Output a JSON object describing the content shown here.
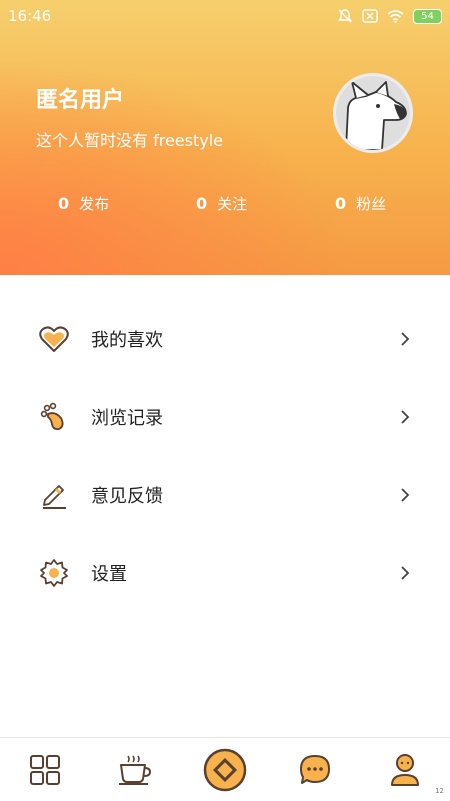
{
  "status_bar": {
    "time": "16:46",
    "battery": "54"
  },
  "profile": {
    "name": "匿名用户",
    "bio": "这个人暂时没有 freestyle"
  },
  "stats": [
    {
      "value": "0",
      "label": "发布"
    },
    {
      "value": "0",
      "label": "关注"
    },
    {
      "value": "0",
      "label": "粉丝"
    }
  ],
  "menu": [
    {
      "label": "我的喜欢",
      "icon": "heart-icon"
    },
    {
      "label": "浏览记录",
      "icon": "footprint-icon"
    },
    {
      "label": "意见反馈",
      "icon": "pencil-icon"
    },
    {
      "label": "设置",
      "icon": "gear-icon"
    }
  ],
  "bottom_nav": [
    {
      "icon": "grid-icon"
    },
    {
      "icon": "coffee-cup-icon"
    },
    {
      "icon": "center-diamond-icon"
    },
    {
      "icon": "chat-bubble-icon"
    },
    {
      "icon": "profile-icon"
    }
  ],
  "corner_number": "12",
  "colors": {
    "accent": "#f7b24d",
    "accent_dark": "#f08f3b",
    "icon_outline": "#5a4030"
  }
}
